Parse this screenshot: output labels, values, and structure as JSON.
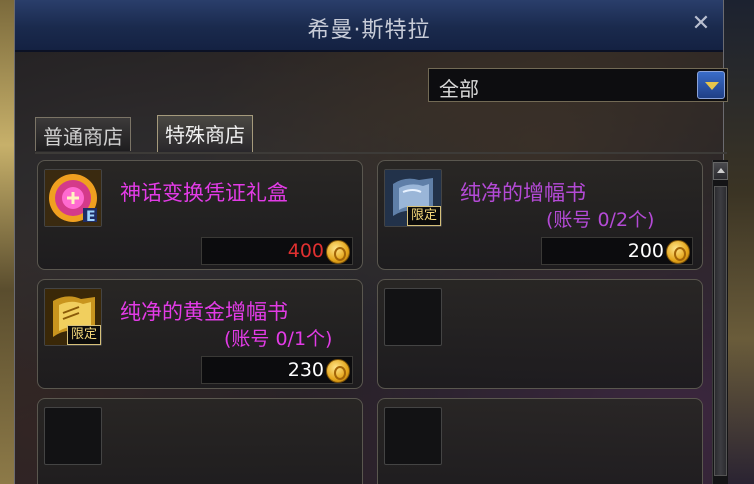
{
  "window": {
    "title": "希曼·斯特拉"
  },
  "filter": {
    "selected": "全部"
  },
  "tabs": [
    {
      "label": "普通商店",
      "active": false
    },
    {
      "label": "特殊商店",
      "active": true
    }
  ],
  "items": [
    {
      "icon": "gift-box-icon",
      "name": "神话变换凭证礼盒",
      "limit": "",
      "price": "400",
      "price_color": "#e03030",
      "name_color": "#e23be6",
      "limited": false
    },
    {
      "icon": "book-icon",
      "name": "纯净的增幅书",
      "limit": "(账号 0/2个)",
      "price": "200",
      "price_color": "#ffffff",
      "name_color": "#b44ad6",
      "limited": true,
      "limited_label": "限定"
    },
    {
      "icon": "golden-book-icon",
      "name": "纯净的黄金增幅书",
      "limit": "(账号 0/1个)",
      "price": "230",
      "price_color": "#ffffff",
      "name_color": "#e23be6",
      "limited": true,
      "limited_label": "限定"
    }
  ],
  "icons": {
    "close": "close-icon",
    "dropdown": "chevron-down-icon",
    "currency": "gold-coin-icon"
  }
}
